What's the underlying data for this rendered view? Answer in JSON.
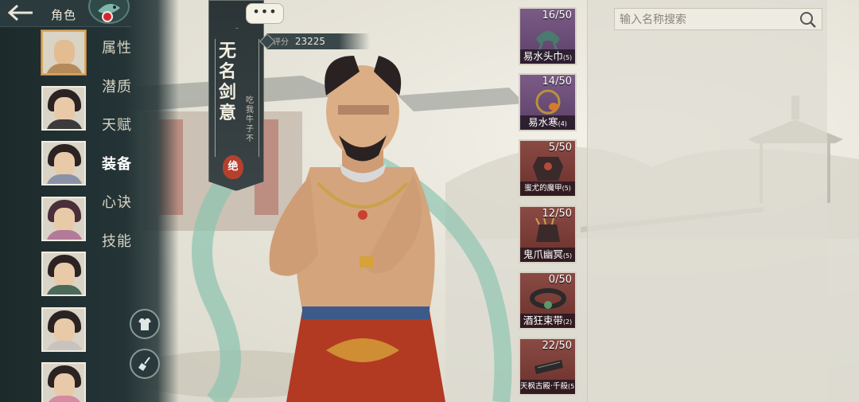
{
  "header": {
    "back_icon": "back-arrow-icon",
    "title": "角色",
    "badge_icon": "fish-icon"
  },
  "nav": {
    "items": [
      {
        "label": "属性"
      },
      {
        "label": "潜质"
      },
      {
        "label": "天赋"
      },
      {
        "label": "装备",
        "active": true
      },
      {
        "label": "心诀"
      },
      {
        "label": "技能"
      }
    ]
  },
  "sidebar_buttons": {
    "outfit_icon": "clothes-icon",
    "clean_icon": "broom-icon"
  },
  "speech_bubble": "•••",
  "set": {
    "name": "无名剑意",
    "owner": "吃我牛子不",
    "grade": "绝"
  },
  "score": {
    "label": "评分",
    "value": "23225"
  },
  "equipment": [
    {
      "count": "16/50",
      "name": "易水头巾",
      "qty": "(5)",
      "rarity": "purple",
      "icon": "headscarf-icon"
    },
    {
      "count": "14/50",
      "name": "易水寒",
      "qty": "(4)",
      "rarity": "purple",
      "icon": "amulet-icon"
    },
    {
      "count": "5/50",
      "name": "蚩尤的魔甲",
      "qty": "(5)",
      "rarity": "red",
      "icon": "armor-icon"
    },
    {
      "count": "12/50",
      "name": "鬼爪幽冥",
      "qty": "(5)",
      "rarity": "red",
      "icon": "gauntlet-icon"
    },
    {
      "count": "0/50",
      "name": "酒狂束带",
      "qty": "(2)",
      "rarity": "red",
      "icon": "belt-icon"
    },
    {
      "count": "22/50",
      "name": "天枫古殿·千殺",
      "qty": "(5)",
      "rarity": "red",
      "icon": "boots-icon"
    }
  ],
  "search": {
    "placeholder": "输入名称搜索",
    "icon": "search-icon"
  },
  "colors": {
    "sidebar": "#243436",
    "purple_rarity": "#6c4d78",
    "red_rarity": "#7a3c37",
    "grade_red": "#b5402e"
  }
}
